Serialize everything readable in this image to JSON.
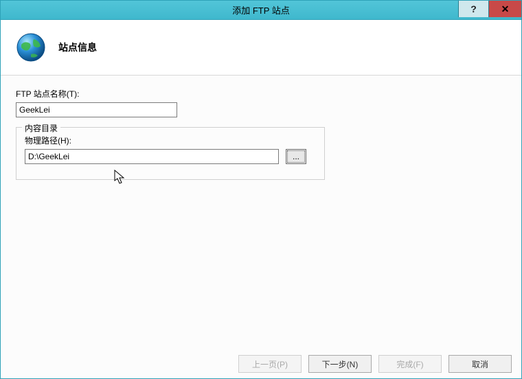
{
  "titlebar": {
    "title": "添加 FTP 站点",
    "help_label": "?",
    "close_label": "✕"
  },
  "header": {
    "title": "站点信息"
  },
  "form": {
    "site_name_label": "FTP 站点名称(T):",
    "site_name_value": "GeekLei",
    "content_dir_legend": "内容目录",
    "physical_path_label": "物理路径(H):",
    "physical_path_value": "D:\\GeekLei",
    "browse_label": "..."
  },
  "footer": {
    "prev": "上一页(P)",
    "next": "下一步(N)",
    "finish": "完成(F)",
    "cancel": "取消"
  }
}
